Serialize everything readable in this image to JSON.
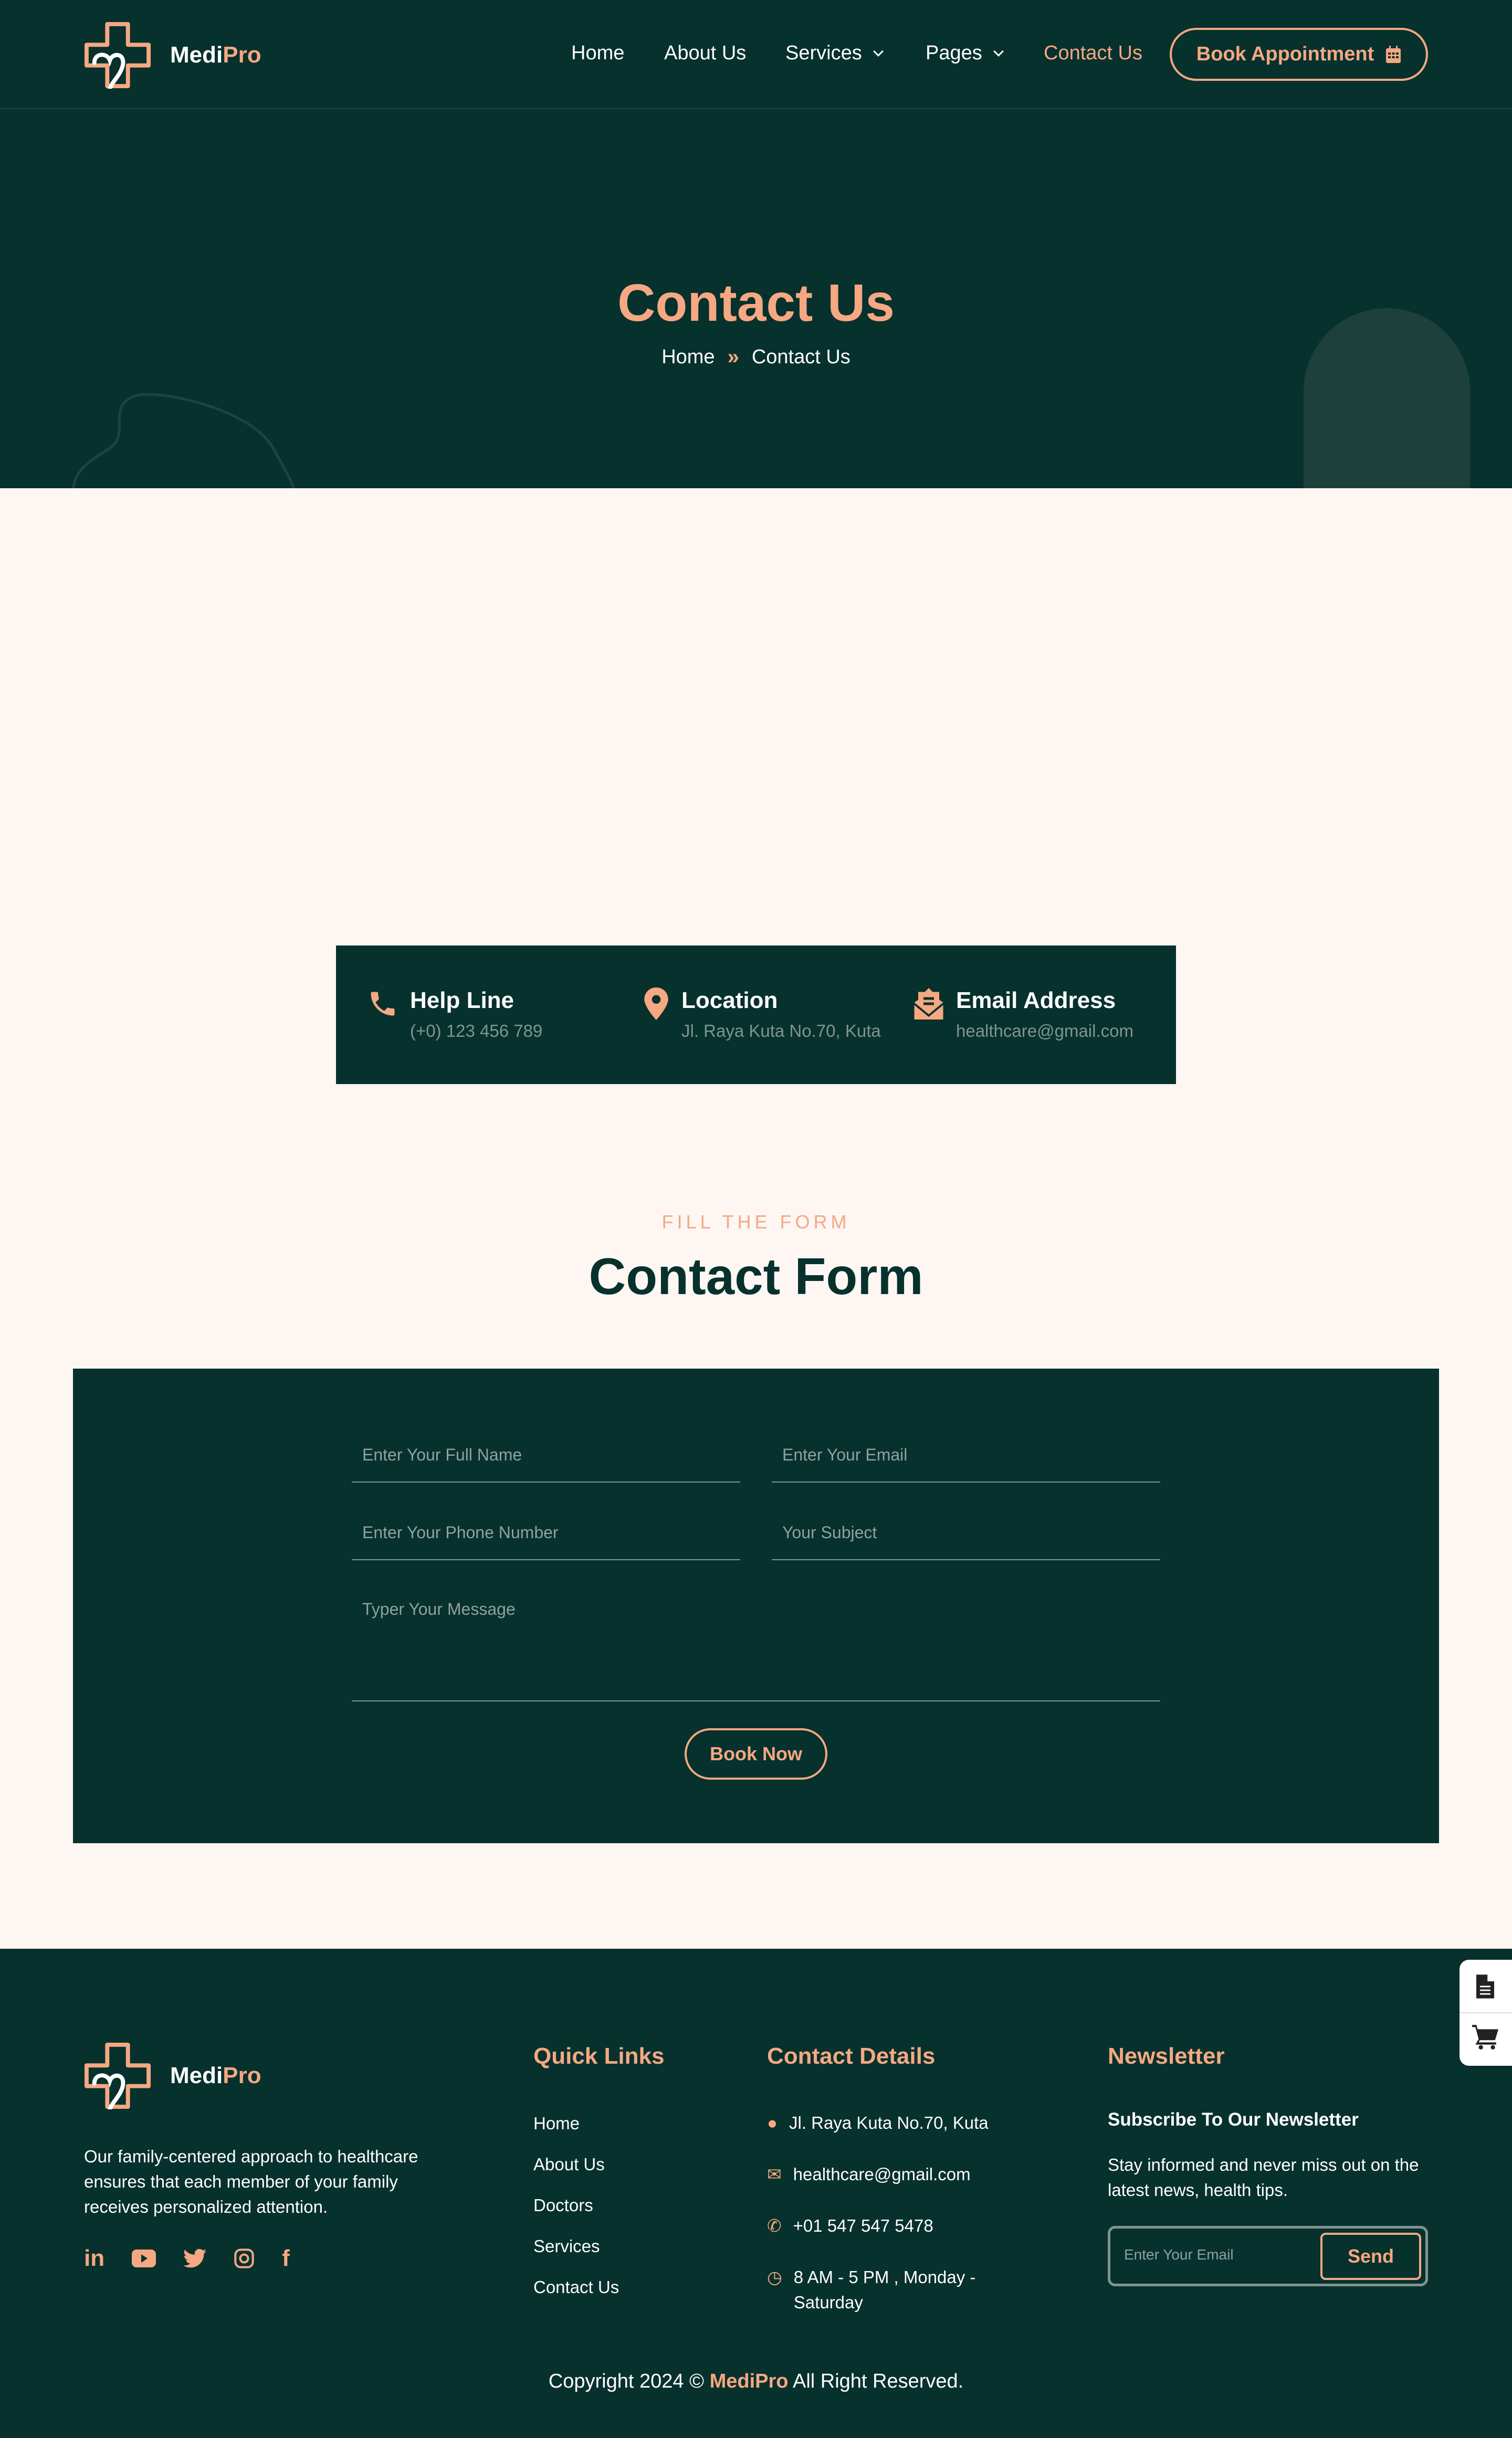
{
  "brand": {
    "name_a": "Medi",
    "name_b": "Pro"
  },
  "nav": {
    "items": [
      "Home",
      "About Us",
      "Services",
      "Pages",
      "Contact Us"
    ],
    "book": "Book Appointment"
  },
  "hero": {
    "title": "Contact Us",
    "crumb_home": "Home",
    "crumb_current": "Contact Us"
  },
  "info": [
    {
      "title": "Help Line",
      "sub": "(+0) 123 456 789",
      "icon": "phone-icon"
    },
    {
      "title": "Location",
      "sub": "Jl. Raya Kuta No.70, Kuta",
      "icon": "map-pin-icon"
    },
    {
      "title": "Email Address",
      "sub": "healthcare@gmail.com",
      "icon": "envelope-open-icon"
    }
  ],
  "form": {
    "eyebrow": "FILL THE FORM",
    "title": "Contact Form",
    "name_ph": "Enter Your Full Name",
    "email_ph": "Enter Your Email",
    "phone_ph": "Enter Your Phone Number",
    "subject_ph": "Your Subject",
    "message_ph": "Typer Your Message",
    "submit": "Book Now"
  },
  "footer": {
    "desc": "Our family-centered approach to healthcare ensures that each member of your family receives personalized attention.",
    "quick_title": "Quick Links",
    "quick": [
      "Home",
      "About Us",
      "Doctors",
      "Services",
      "Contact Us"
    ],
    "contact_title": "Contact Details",
    "contact": [
      "Jl. Raya Kuta No.70, Kuta",
      "healthcare@gmail.com",
      "+01 547 547 5478",
      "8 AM - 5 PM , Monday - Saturday"
    ],
    "news_title": "Newsletter",
    "news_sub": "Subscribe To Our Newsletter",
    "news_text": "Stay informed and never miss out on the latest news, health tips.",
    "news_ph": "Enter Your Email",
    "news_btn": "Send",
    "copy_a": "Copyright 2024 ©",
    "copy_brand": "MediPro",
    "copy_b": "All Right Reserved."
  },
  "colors": {
    "dark": "#07312d",
    "accent": "#f5a882",
    "bg": "#fdf6f3"
  }
}
